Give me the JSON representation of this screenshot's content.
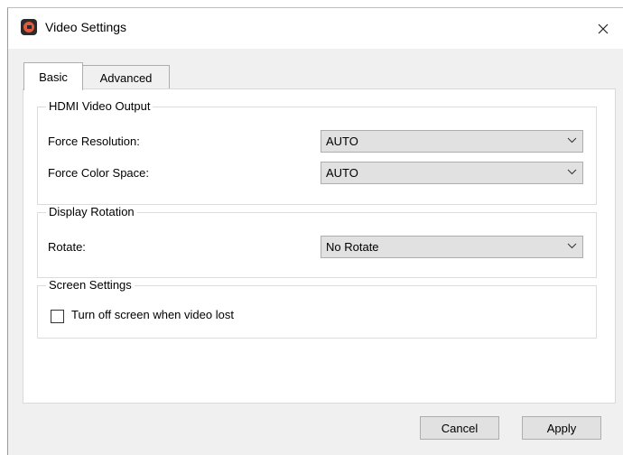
{
  "window": {
    "title": "Video Settings"
  },
  "tabs": [
    {
      "label": "Basic"
    },
    {
      "label": "Advanced"
    }
  ],
  "hdmi_group": {
    "title": "HDMI Video Output",
    "resolution_label": "Force Resolution:",
    "resolution_value": "AUTO",
    "color_space_label": "Force Color Space:",
    "color_space_value": "AUTO"
  },
  "rotation_group": {
    "title": "Display Rotation",
    "rotate_label": "Rotate:",
    "rotate_value": "No Rotate"
  },
  "screen_group": {
    "title": "Screen Settings",
    "turn_off_label": "Turn off screen when video lost",
    "turn_off_checked": false
  },
  "buttons": {
    "cancel": "Cancel",
    "apply": "Apply"
  },
  "icons": {
    "close": "close-icon",
    "dropdown": "chevron-down-icon",
    "app": "app-logo-icon"
  }
}
